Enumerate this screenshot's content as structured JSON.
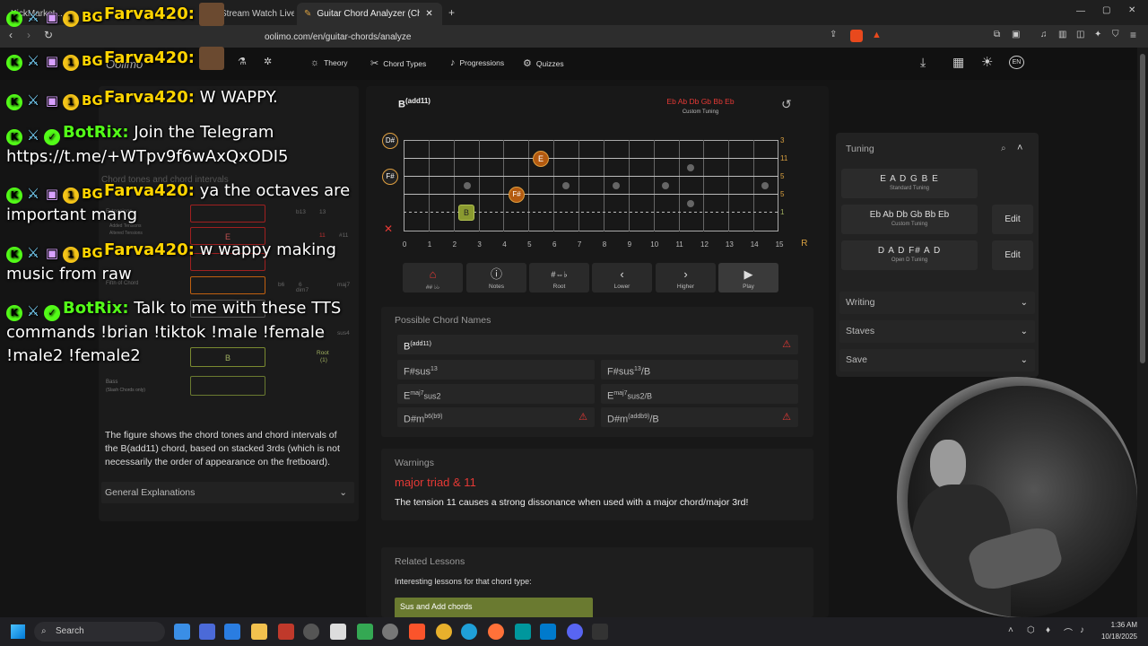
{
  "browser": {
    "tabs": [
      {
        "label": "KickMarket...",
        "active": false
      },
      {
        "label": "Stream Watch Live on Kick",
        "active": false
      },
      {
        "label": "Guitar Chord Analyzer (Chord N...",
        "active": true
      }
    ],
    "url": "oolimo.com/en/guitar-chords/analyze",
    "new_tab": "+",
    "window_controls": [
      "—",
      "▢",
      "✕"
    ]
  },
  "site": {
    "logo": "Oolimo",
    "nav": [
      {
        "label": "Theory",
        "icon": "bulb-icon"
      },
      {
        "label": "Chord Types",
        "icon": "scissors-icon"
      },
      {
        "label": "Progressions",
        "icon": "figure-icon"
      },
      {
        "label": "Quizzes",
        "icon": "quiz-icon"
      }
    ],
    "lang": "EN"
  },
  "chat": [
    {
      "user": "Farva420:",
      "color": "yellow",
      "msg": "W WAPPY."
    },
    {
      "user": "BotRix:",
      "color": "green",
      "msg": "Join the Telegram https://t.me/+WTpv9f6wAxQxODI5"
    },
    {
      "user": "Farva420:",
      "color": "yellow",
      "msg": "ya the octaves are important mang"
    },
    {
      "user": "Farva420:",
      "color": "yellow",
      "msg": "w wappy making music from raw"
    },
    {
      "user": "BotRix:",
      "color": "green",
      "msg": "Talk to me with these TTS commands !brian !tiktok !male !female !male2 !female2"
    }
  ],
  "chat_top": [
    {
      "user": "Farva420:"
    },
    {
      "user": "Farva420:"
    }
  ],
  "left": {
    "heading": "Chord tones and chord intervals",
    "labels": {
      "extensions": "Extensions",
      "ext_sub1": "Added Tensions",
      "ext_sub2": "Altered Tensions",
      "fifth": "Fifth of Chord",
      "root": "Root",
      "root_num": "(1)",
      "bass": "Bass",
      "bass_sub": "(Slash Chords only)"
    },
    "boxes": [
      "",
      "E",
      "",
      "",
      "",
      "B",
      ""
    ],
    "intervals": [
      "b13",
      "13",
      "11",
      "#11",
      "b9",
      "9",
      "b6",
      "6",
      "maj7",
      "dim7",
      "3",
      "sus4",
      "sus2"
    ],
    "description": "The figure shows the chord tones and chord intervals of the B(add11) chord, based on stacked 3rds (which is not necessarily the order of appearance on the fretboard).",
    "explanations": "General Explanations"
  },
  "fretboard": {
    "chord": "B",
    "chord_sup": "(add11)",
    "tuning_notes": "Eb Ab Db Gb Bb Eb",
    "tuning_label": "Custom Tuning",
    "string_labels": [
      "3",
      "11",
      "5",
      "5",
      "1"
    ],
    "open_notes": [
      "D#",
      "F#"
    ],
    "muted": "✕",
    "fret_numbers": [
      "0",
      "1",
      "2",
      "3",
      "4",
      "5",
      "6",
      "7",
      "8",
      "9",
      "10",
      "11",
      "12",
      "13",
      "14",
      "15",
      "R"
    ],
    "placed_notes": [
      "E",
      "F#",
      "B"
    ]
  },
  "controls": [
    {
      "label": "## ♭♭",
      "icon": "hat-icon"
    },
    {
      "label": "Notes",
      "icon": "info-icon"
    },
    {
      "label": "Root",
      "icon": "sharp-flat-icon"
    },
    {
      "label": "Lower",
      "icon": "chevron-left-icon"
    },
    {
      "label": "Higher",
      "icon": "chevron-right-icon"
    },
    {
      "label": "Play",
      "icon": "play-icon"
    }
  ],
  "possible": {
    "heading": "Possible Chord Names",
    "primary": {
      "root": "B",
      "sup": "(add11)"
    },
    "names": [
      {
        "base": "F#sus",
        "sup": "13",
        "tail": ""
      },
      {
        "base": "F#sus",
        "sup": "13",
        "tail": "/B"
      },
      {
        "base": "E",
        "sup": "maj7",
        "tail": "sus2"
      },
      {
        "base": "E",
        "sup": "maj7",
        "tail": "sus2/B"
      },
      {
        "base": "D#m",
        "sup": "b6(b9)",
        "tail": ""
      },
      {
        "base": "D#m",
        "sup": "(addb9)",
        "tail": "/B"
      }
    ]
  },
  "warnings": {
    "heading": "Warnings",
    "title": "major triad & 11",
    "text": "The tension 11 causes a strong dissonance when used with a major chord/major 3rd!"
  },
  "related": {
    "heading": "Related Lessons",
    "intro": "Interesting lessons for that chord type:",
    "lesson": "Sus and Add chords"
  },
  "tuning": {
    "heading": "Tuning",
    "cards": [
      {
        "notes": "E A D G B E",
        "label": "Standard Tuning",
        "edit": ""
      },
      {
        "notes": "Eb Ab Db Gb Bb Eb",
        "label": "Custom Tuning",
        "edit": "Edit"
      },
      {
        "notes": "D A D F# A D",
        "label": "Open D Tuning",
        "edit": "Edit"
      }
    ],
    "sections": [
      "Writing",
      "Staves",
      "Save"
    ]
  },
  "taskbar": {
    "search": "Search",
    "time": "1:36 AM",
    "date": "10/18/2025"
  },
  "colors": {
    "accent_orange": "#d9a040",
    "warning_red": "#e53935",
    "kick_green": "#53fc18",
    "chat_yellow": "#ffd400"
  }
}
